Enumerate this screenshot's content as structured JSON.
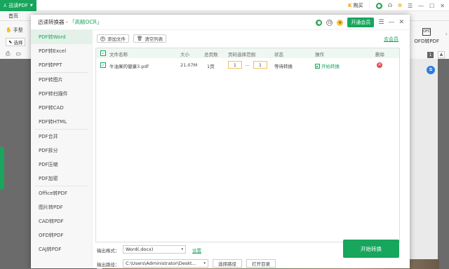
{
  "app": {
    "name": "迅读PDF"
  },
  "topbar": {
    "buy": "购买"
  },
  "subbar": {
    "home": "首页"
  },
  "tools": {
    "hand": "手型",
    "select": "选择"
  },
  "right_panel": {
    "ofd_label": "OFD转PDF",
    "ofd_icon_text": "OFD",
    "page_num": "1"
  },
  "dialog": {
    "title": "迅读转换器 - ",
    "title_ocr": "「高精OCR」",
    "vip_button": "开通会员",
    "nav": [
      "PDF转Word",
      "PDF转Excel",
      "PDF转PPT",
      "PDF转图片",
      "PDF转扫描件",
      "PDF转CAD",
      "PDF转HTML",
      "PDF合并",
      "PDF拆分",
      "PDF压缩",
      "PDF加密",
      "Office转PDF",
      "图片转PDF",
      "CAD转PDF",
      "OFD转PDF",
      "CAJ转PDF"
    ],
    "add_file": "添加文件",
    "clear_list": "清空列表",
    "member_link": "去会员",
    "table": {
      "headers": [
        "文件名称",
        "大小",
        "总页数",
        "页码选择范围",
        "状态",
        "操作",
        "删除"
      ],
      "rows": [
        {
          "name": "牛油果的健康3.pdf",
          "size": "21.07M",
          "pages": "1页",
          "from": "1",
          "dash": "—",
          "to": "1",
          "status": "等待转换",
          "action": "开始转换"
        }
      ]
    },
    "output_format_label": "输出格式：",
    "output_format_value": "Word(.docx)",
    "settings_link": "设置",
    "output_path_label": "输出路径：",
    "output_path_value": "C:\\Users\\Administrator\\Deskt...",
    "choose_path": "选择路径",
    "open_dir": "打开目录",
    "start_button": "开始转换"
  }
}
